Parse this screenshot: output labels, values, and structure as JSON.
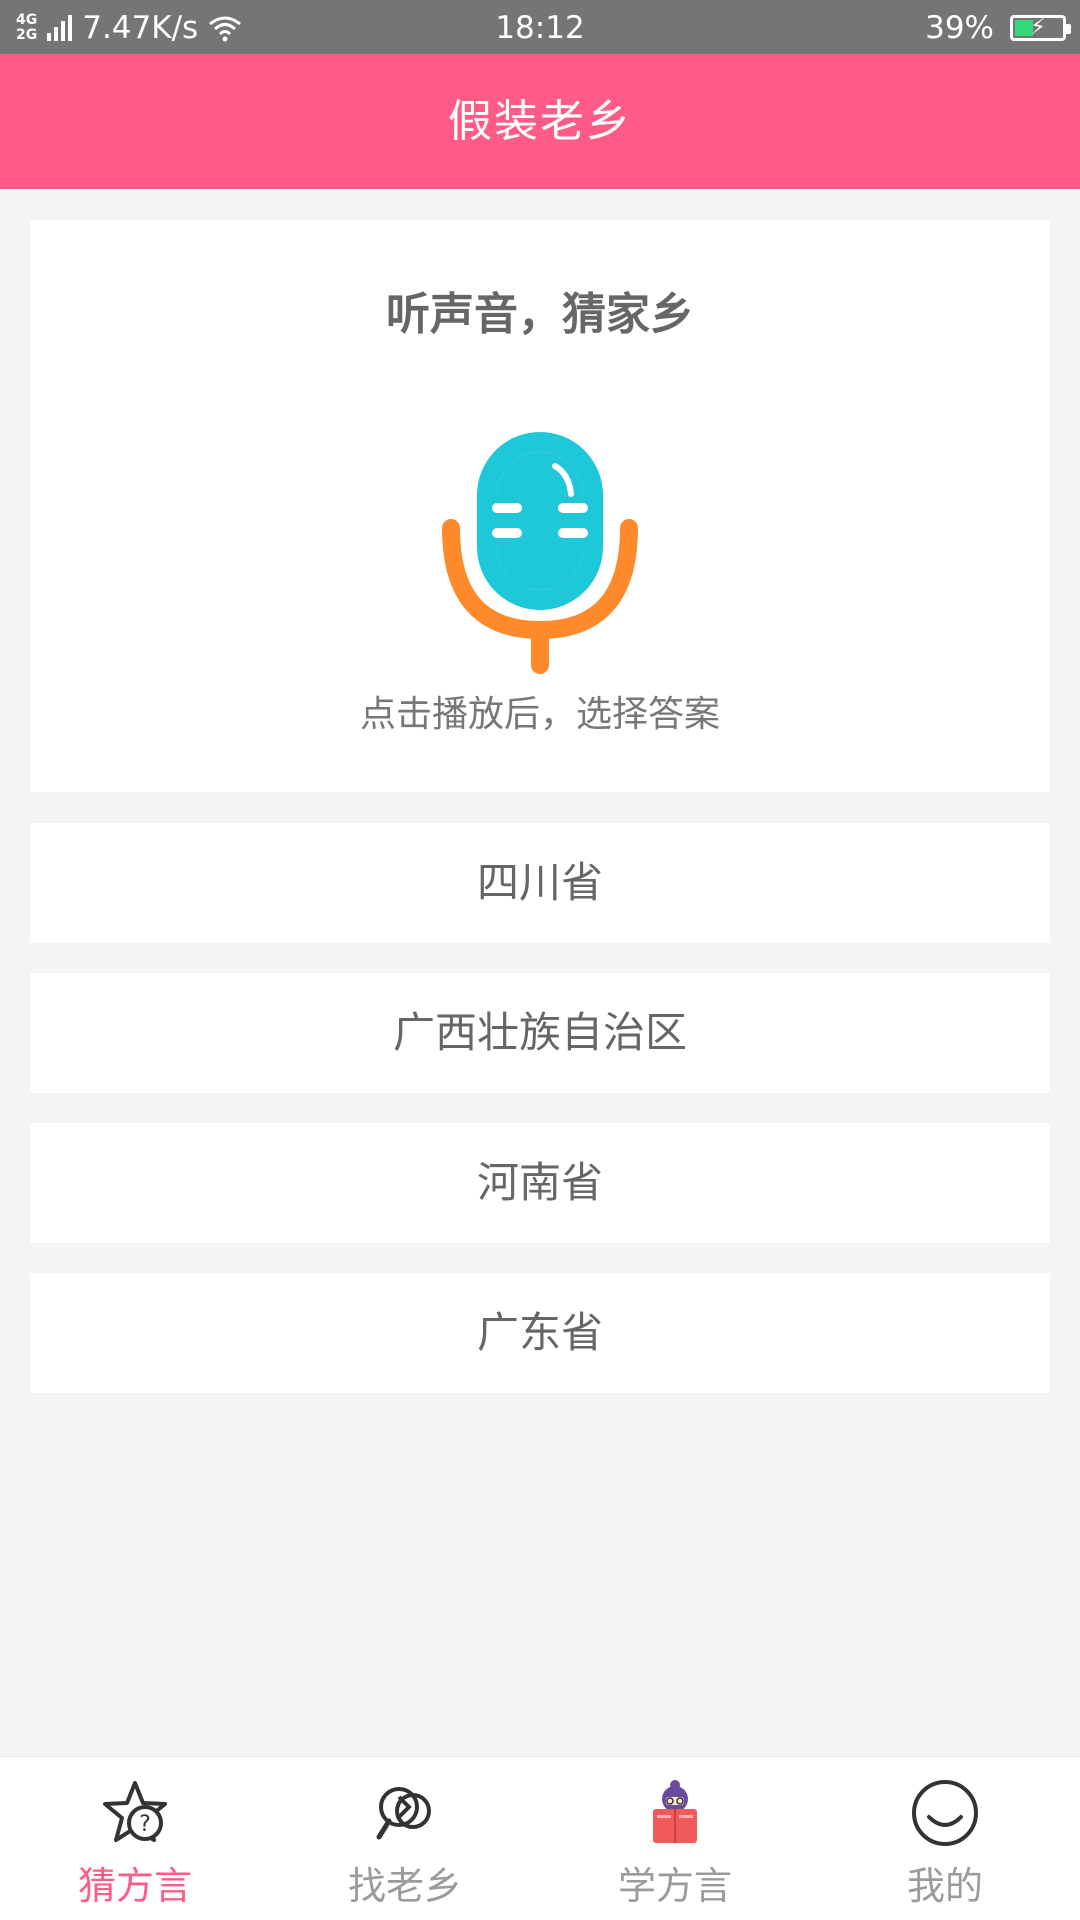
{
  "status_bar": {
    "network_top": "4G",
    "network_bottom": "2G",
    "speed": "7.47K/s",
    "time": "18:12",
    "battery": "39%",
    "battery_level": 0.39
  },
  "header": {
    "title": "假装老乡"
  },
  "card": {
    "heading": "听声音，猜家乡",
    "hint": "点击播放后，选择答案",
    "mic_icon": "microphone-icon"
  },
  "options": [
    {
      "label": "四川省"
    },
    {
      "label": "广西壮族自治区"
    },
    {
      "label": "河南省"
    },
    {
      "label": "广东省"
    }
  ],
  "bottom_nav": {
    "items": [
      {
        "label": "猜方言",
        "icon": "star-question-icon",
        "active": true
      },
      {
        "label": "找老乡",
        "icon": "search-people-icon",
        "active": false
      },
      {
        "label": "学方言",
        "icon": "reading-book-icon",
        "active": false
      },
      {
        "label": "我的",
        "icon": "smiley-face-icon",
        "active": false
      }
    ]
  },
  "colors": {
    "primary": "#ff5b87",
    "mic_cyan": "#1fc8d8",
    "mic_orange": "#ff8a2c",
    "background": "#f4f4f4"
  }
}
